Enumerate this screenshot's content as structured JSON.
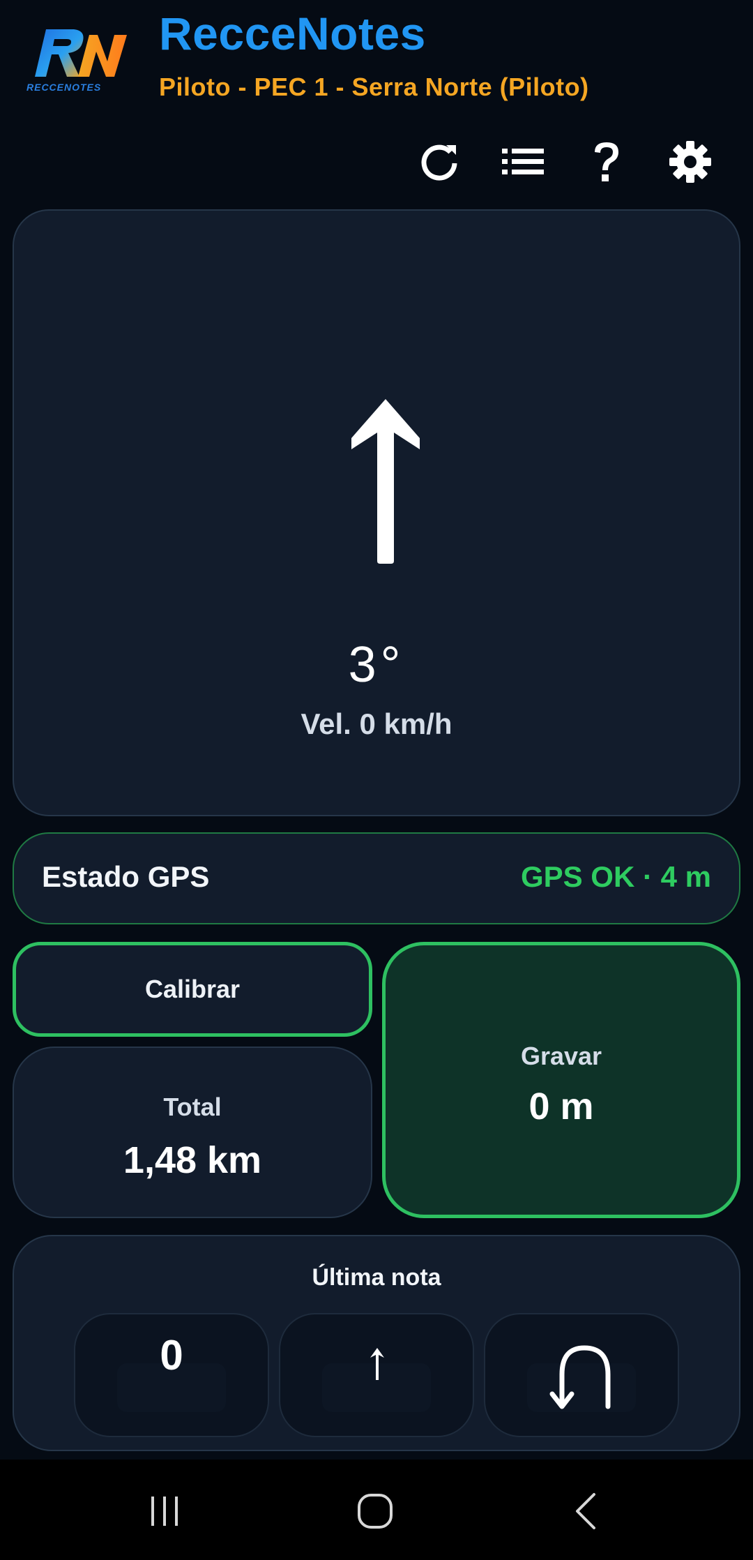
{
  "header": {
    "logo_text": "RECCENOTES",
    "title": "RecceNotes",
    "subtitle": "Piloto - PEC 1 - Serra Norte (Piloto)",
    "toolbar": [
      {
        "icon": "refresh-icon"
      },
      {
        "icon": "list-icon"
      },
      {
        "icon": "help-icon"
      },
      {
        "icon": "settings-gear-icon"
      }
    ]
  },
  "compass": {
    "arrow_icon": "up-arrow-icon",
    "heading": "3°",
    "speed": "Vel. 0 km/h"
  },
  "gps": {
    "label": "Estado GPS",
    "status": "GPS OK · 4 m",
    "status_color": "#2ecc60"
  },
  "calibrate": {
    "label": "Calibrar"
  },
  "total": {
    "label": "Total",
    "value": "1,48 km"
  },
  "record": {
    "label": "Gravar",
    "value": "0 m",
    "accent": "#2ec061"
  },
  "last_note": {
    "title": "Última nota",
    "number": "0",
    "direction_icon": "small-up-arrow-icon",
    "turn_icon": "u-turn-left-icon"
  },
  "colors": {
    "brand_blue": "#2196f3",
    "brand_orange": "#f5a623",
    "ok_green": "#2ecc60",
    "background": "#050b14",
    "card": "#121c2c"
  },
  "nav_bar": [
    {
      "icon": "recent-apps-icon"
    },
    {
      "icon": "home-icon"
    },
    {
      "icon": "back-icon"
    }
  ]
}
